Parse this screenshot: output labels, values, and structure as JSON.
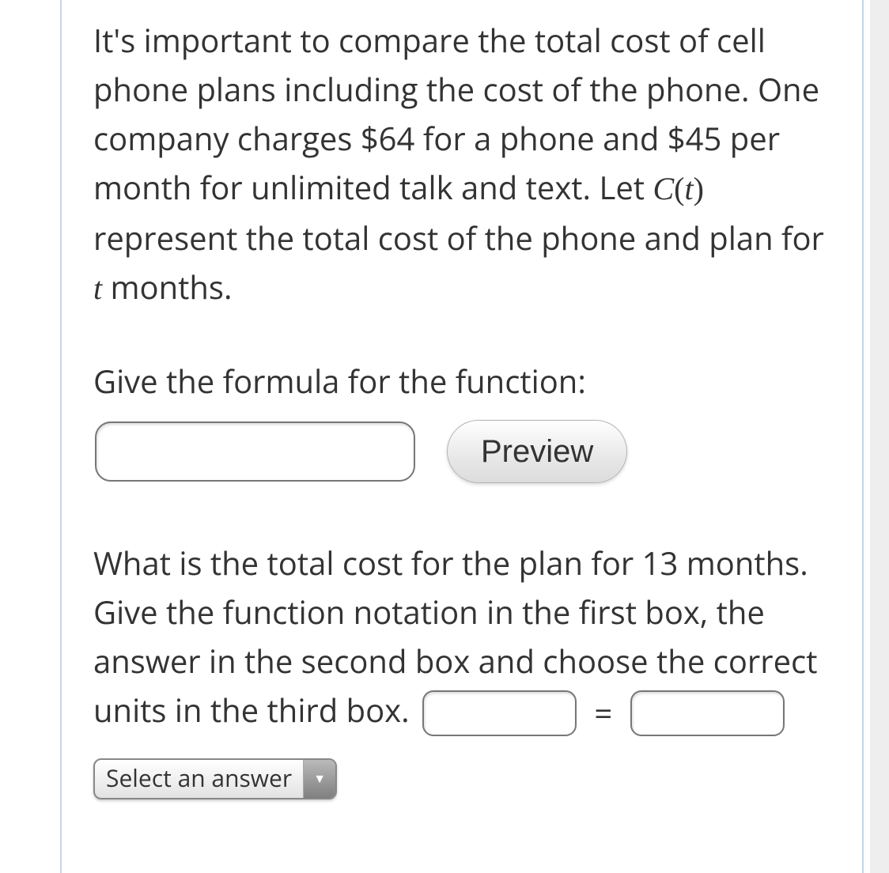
{
  "question": {
    "text_intro": "It's important to compare the total cost of cell phone plans including the cost of the phone. One company charges $64 for a phone and $45 per month for unlimited talk and text. Let ",
    "func_symbol": "C",
    "func_paren_open": "(",
    "func_arg": "t",
    "func_paren_close": ")",
    "text_mid": " represent the total cost of the phone and plan for ",
    "var_t": "t",
    "text_end": " months."
  },
  "prompt1": "Give the formula for the function:",
  "input_formula": "",
  "preview_label": "Preview",
  "prompt2_a": "What is the total cost for the plan for 13 months. Give the function notation in the first box, the answer in the second box and choose the correct units in the third box.",
  "equals": "=",
  "input_notation": "",
  "input_answer": "",
  "select": {
    "placeholder": "Select an answer"
  }
}
